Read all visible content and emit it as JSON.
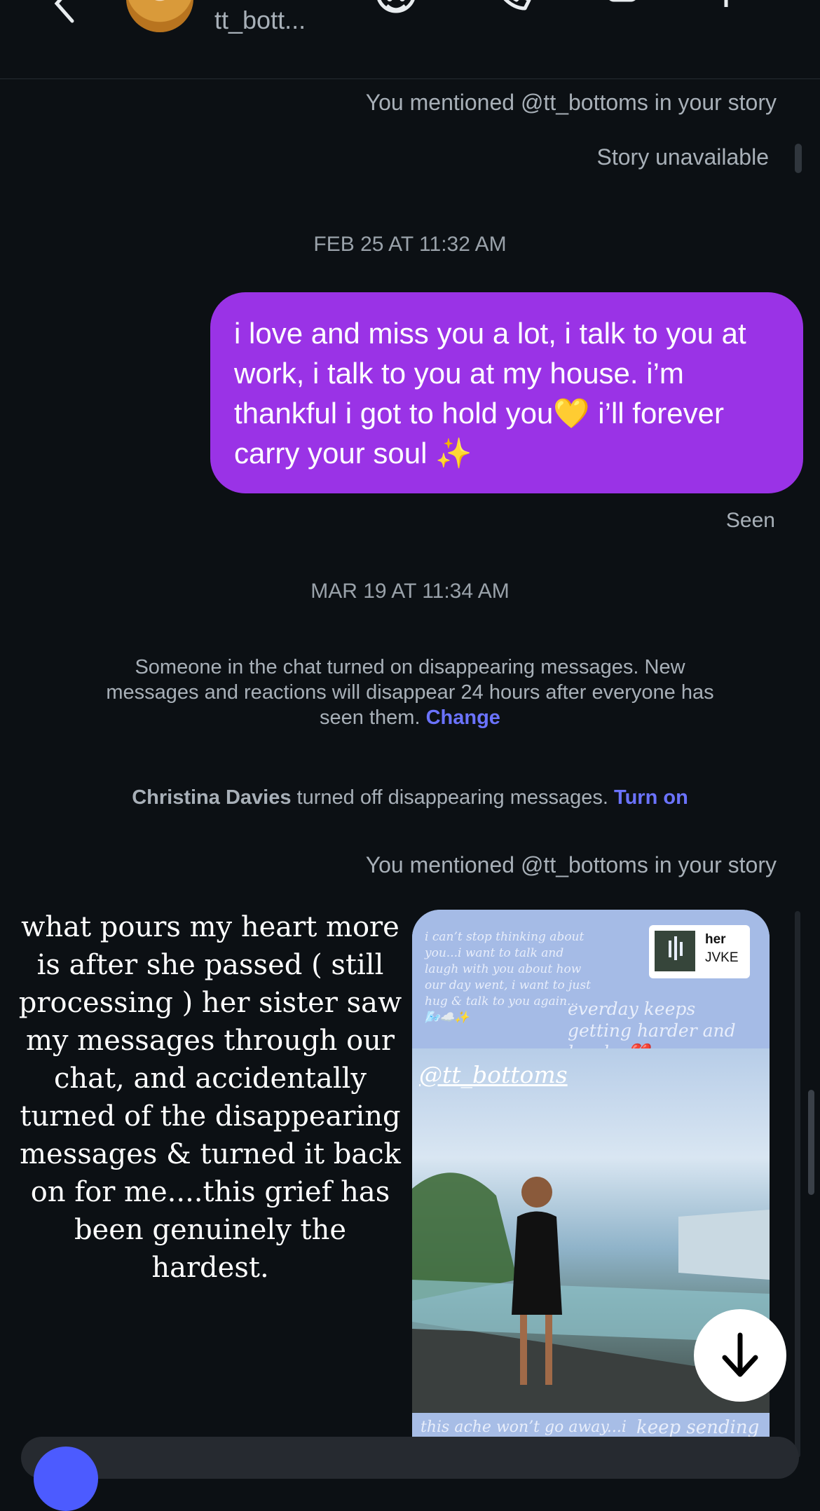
{
  "header": {
    "username": "tt_bott...",
    "icons": [
      "back-icon",
      "avatar",
      "sticker-icon",
      "phone-icon",
      "video-icon",
      "flag-icon"
    ]
  },
  "messages": {
    "mention1": "You mentioned @tt_bottoms in your story",
    "story_unavailable": "Story unavailable",
    "date1": "FEB 25 AT 11:32 AM",
    "bubble_text": "i love and miss you a lot, i talk to you at work, i talk to you at my house. i’m thankful i got to hold you💛 i’ll forever carry your soul ✨",
    "seen": "Seen",
    "date2": "MAR 19 AT 11:34 AM",
    "notice_text": "Someone in the chat turned on disappearing messages. New messages and reactions will disappear 24 hours after everyone has seen them.",
    "notice_link": "Change",
    "turnoff_name": "Christina Davies",
    "turnoff_text": "turned off disappearing messages.",
    "turnoff_link": "Turn on",
    "mention2": "You mentioned @tt_bottoms in your story"
  },
  "overlay_note": "what pours my heart more is after she passed ( still processing ) her sister saw my messages through our chat, and accidentally turned of the disappearing messages & turned it back on for me....this grief has been genuinely the hardest.",
  "story": {
    "top_text": "i can’t stop thinking about you...i want to talk and laugh with you about how our day went, i want to just hug & talk to you again...🌬️☁️✨",
    "caption": "everday keeps getting harder and harder💔",
    "mention": "@tt_bottoms",
    "music_title": "her",
    "music_artist": "JVKE",
    "bottom_left": "this ache won’t go away...i",
    "bottom_right": "keep sending"
  },
  "colors": {
    "background": "#0c1014",
    "bubble": "#9a33e6",
    "link": "#6b73ff"
  }
}
